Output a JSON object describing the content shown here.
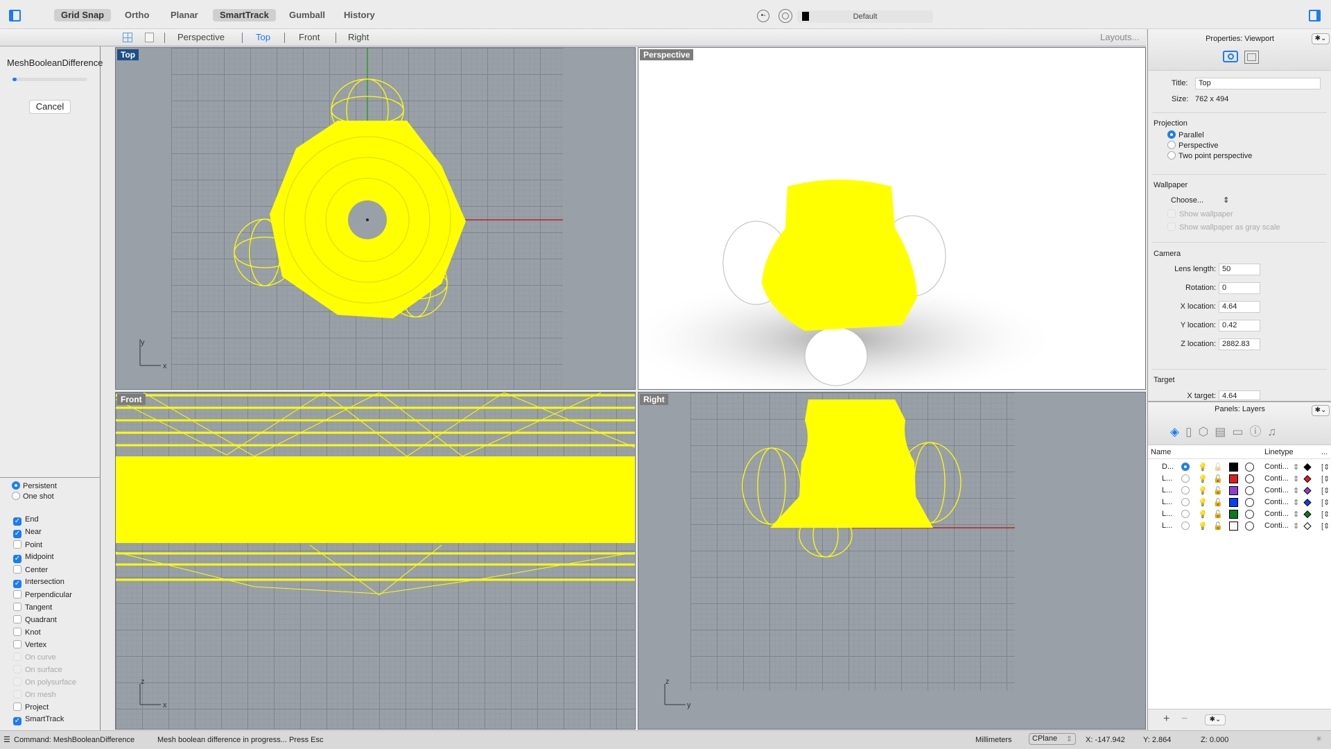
{
  "toolbar": {
    "buttons": [
      {
        "label": "Grid Snap",
        "active": true
      },
      {
        "label": "Ortho",
        "active": false
      },
      {
        "label": "Planar",
        "active": false
      },
      {
        "label": "SmartTrack",
        "active": true
      },
      {
        "label": "Gumball",
        "active": false
      },
      {
        "label": "History",
        "active": false
      }
    ],
    "layer_name": "Default",
    "layer_color": "#000000"
  },
  "viewport_tabs": {
    "tabs": [
      "Perspective",
      "Top",
      "Front",
      "Right"
    ],
    "active": "Top",
    "layouts": "Layouts..."
  },
  "command_panel": {
    "title": "MeshBooleanDifference",
    "progress": 0.03,
    "cancel": "Cancel"
  },
  "osnap": {
    "modes": [
      {
        "label": "Persistent",
        "selected": true
      },
      {
        "label": "One shot",
        "selected": false
      }
    ],
    "items": [
      {
        "label": "End",
        "checked": true,
        "enabled": true
      },
      {
        "label": "Near",
        "checked": true,
        "enabled": true
      },
      {
        "label": "Point",
        "checked": false,
        "enabled": true
      },
      {
        "label": "Midpoint",
        "checked": true,
        "enabled": true
      },
      {
        "label": "Center",
        "checked": false,
        "enabled": true
      },
      {
        "label": "Intersection",
        "checked": true,
        "enabled": true
      },
      {
        "label": "Perpendicular",
        "checked": false,
        "enabled": true
      },
      {
        "label": "Tangent",
        "checked": false,
        "enabled": true
      },
      {
        "label": "Quadrant",
        "checked": false,
        "enabled": true
      },
      {
        "label": "Knot",
        "checked": false,
        "enabled": true
      },
      {
        "label": "Vertex",
        "checked": false,
        "enabled": true
      },
      {
        "label": "On curve",
        "checked": false,
        "enabled": false
      },
      {
        "label": "On surface",
        "checked": false,
        "enabled": false
      },
      {
        "label": "On polysurface",
        "checked": false,
        "enabled": false
      },
      {
        "label": "On mesh",
        "checked": false,
        "enabled": false
      },
      {
        "label": "Project",
        "checked": false,
        "enabled": true
      },
      {
        "label": "SmartTrack",
        "checked": true,
        "enabled": true
      }
    ]
  },
  "viewports": {
    "top": {
      "label": "Top",
      "axis_x": "x",
      "axis_y": "y"
    },
    "perspective": {
      "label": "Perspective"
    },
    "front": {
      "label": "Front",
      "axis_x": "x",
      "axis_y": "z"
    },
    "right": {
      "label": "Right",
      "axis_x": "y",
      "axis_y": "z"
    },
    "object_color": "#ffff00"
  },
  "properties": {
    "header": "Properties: Viewport",
    "title_label": "Title:",
    "title_value": "Top",
    "size_label": "Size:",
    "size_value": "762 x 494",
    "projection": {
      "heading": "Projection",
      "options": [
        {
          "label": "Parallel",
          "selected": true
        },
        {
          "label": "Perspective",
          "selected": false
        },
        {
          "label": "Two point perspective",
          "selected": false
        }
      ]
    },
    "wallpaper": {
      "heading": "Wallpaper",
      "choose": "Choose...",
      "show": "Show wallpaper",
      "gray": "Show wallpaper as gray scale"
    },
    "camera": {
      "heading": "Camera",
      "fields": [
        {
          "label": "Lens length:",
          "value": "50"
        },
        {
          "label": "Rotation:",
          "value": "0"
        },
        {
          "label": "X location:",
          "value": "4.64"
        },
        {
          "label": "Y location:",
          "value": "0.42"
        },
        {
          "label": "Z location:",
          "value": "2882.83"
        }
      ]
    },
    "target": {
      "heading": "Target",
      "x_label": "X target:",
      "x_value": "4.64"
    }
  },
  "layers": {
    "header": "Panels: Layers",
    "col_name": "Name",
    "col_linetype": "Linetype",
    "col_more": "...",
    "rows": [
      {
        "name": "D...",
        "current": true,
        "color": "#000000",
        "linetype": "Conti..."
      },
      {
        "name": "L...",
        "current": false,
        "color": "#dd1c1c",
        "linetype": "Conti..."
      },
      {
        "name": "L...",
        "current": false,
        "color": "#8a3fd1",
        "linetype": "Conti..."
      },
      {
        "name": "L...",
        "current": false,
        "color": "#0a3cff",
        "linetype": "Conti..."
      },
      {
        "name": "L...",
        "current": false,
        "color": "#0a7a1e",
        "linetype": "Conti..."
      },
      {
        "name": "L...",
        "current": false,
        "color": "#ffffff",
        "linetype": "Conti..."
      }
    ],
    "add": "+",
    "remove": "−"
  },
  "status": {
    "command": "Command: MeshBooleanDifference",
    "message": "Mesh boolean difference in progress... Press Esc",
    "units": "Millimeters",
    "cplane": "CPlane",
    "x": "X: -147.942",
    "y": "Y: 2.864",
    "z": "Z: 0.000"
  }
}
